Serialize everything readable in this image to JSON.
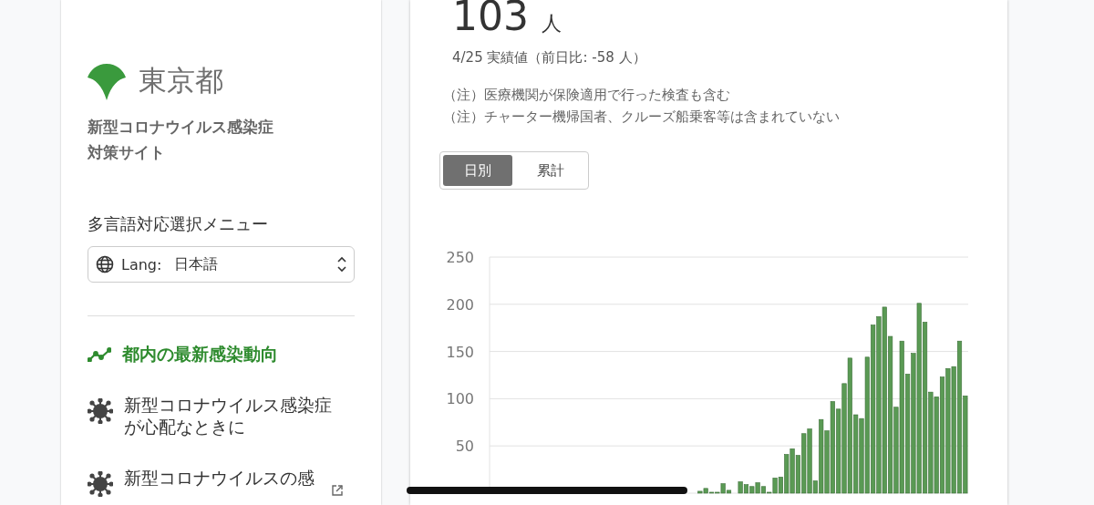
{
  "sidebar": {
    "logo_text": "東京都",
    "site_title": "新型コロナウイルス感染症対策サイト",
    "language_label": "多言語対応選択メニュー",
    "language_select": {
      "prefix": "Lang:",
      "value": "日本語"
    },
    "nav_items": [
      {
        "label": "都内の最新感染動向",
        "selected": true,
        "kind": "trend",
        "external": false
      },
      {
        "label": "新型コロナウイルス感染症が心配なときに",
        "selected": false,
        "kind": "virus",
        "external": false
      },
      {
        "label": "新型コロナウイルスの感",
        "selected": false,
        "kind": "virus",
        "external": true
      }
    ]
  },
  "card": {
    "count": "103",
    "unit": "人",
    "date_note": "4/25 実績値（前日比: -58 人）",
    "notes": [
      "（注）医療機関が保険適用で行った検査も含む",
      "（注）チャーター機帰国者、クルーズ船乗客等は含まれていない"
    ],
    "tabs": [
      {
        "label": "日別",
        "selected": true
      },
      {
        "label": "累計",
        "selected": false
      }
    ],
    "chart_data": {
      "type": "bar",
      "grid": true,
      "ylim": [
        0,
        250
      ],
      "yticks": [
        50,
        100,
        150,
        200,
        250
      ],
      "series": [
        {
          "color": "#5a9a54",
          "values": [
            null,
            null,
            null,
            null,
            null,
            null,
            null,
            null,
            null,
            null,
            null,
            null,
            null,
            null,
            null,
            null,
            null,
            null,
            null,
            null,
            null,
            null,
            null,
            null,
            null,
            null,
            null,
            null,
            null,
            null,
            null,
            null,
            null,
            null,
            null,
            0,
            2,
            5,
            1,
            1,
            10,
            3,
            0,
            12,
            9,
            7,
            11,
            7,
            1,
            16,
            17,
            41,
            47,
            40,
            63,
            68,
            13,
            78,
            66,
            97,
            89,
            116,
            143,
            83,
            79,
            144,
            178,
            187,
            197,
            166,
            91,
            161,
            126,
            148,
            201,
            181,
            107,
            102,
            123,
            132,
            134,
            161,
            103
          ]
        }
      ]
    }
  }
}
